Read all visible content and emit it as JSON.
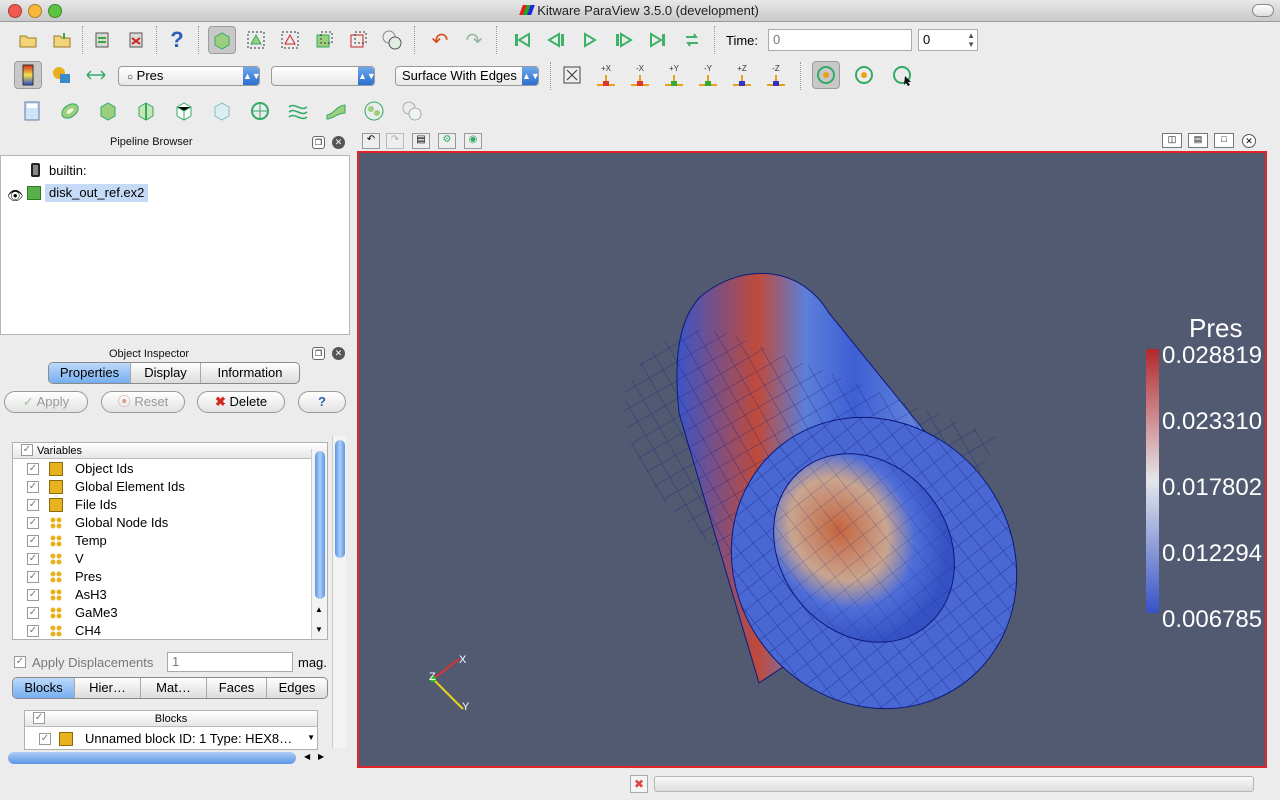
{
  "window": {
    "title": "Kitware ParaView 3.5.0 (development)"
  },
  "toolbar_main": {
    "time_label": "Time:",
    "time_value": "0",
    "time_step": "0"
  },
  "toolbar_color": {
    "array_combo": "Pres",
    "component_combo": "",
    "representation_combo": "Surface With Edges",
    "camera_labels": [
      "+X",
      "-X",
      "+Y",
      "-Y",
      "+Z",
      "-Z"
    ]
  },
  "pipeline": {
    "title": "Pipeline Browser",
    "items": [
      {
        "label": "builtin:"
      },
      {
        "label": "disk_out_ref.ex2"
      }
    ]
  },
  "inspector": {
    "title": "Object Inspector",
    "tabs": [
      {
        "label": "Properties",
        "selected": true
      },
      {
        "label": "Display"
      },
      {
        "label": "Information"
      }
    ],
    "apply_label": "Apply",
    "reset_label": "Reset",
    "delete_label": "Delete",
    "help_label": "?",
    "variables_header": "Variables",
    "variables": [
      {
        "name": "Object Ids",
        "icon": "cell"
      },
      {
        "name": "Global Element Ids",
        "icon": "cell"
      },
      {
        "name": "File Ids",
        "icon": "cell"
      },
      {
        "name": "Global Node Ids",
        "icon": "point"
      },
      {
        "name": "Temp",
        "icon": "point"
      },
      {
        "name": "V",
        "icon": "point"
      },
      {
        "name": "Pres",
        "icon": "point"
      },
      {
        "name": "AsH3",
        "icon": "point"
      },
      {
        "name": "GaMe3",
        "icon": "point"
      },
      {
        "name": "CH4",
        "icon": "point"
      }
    ],
    "apply_displacements_label": "Apply Displacements",
    "displacement_value": "1",
    "mag_label": "mag.",
    "block_tabs": [
      {
        "label": "Blocks",
        "selected": true
      },
      {
        "label": "Hier…"
      },
      {
        "label": "Mat…"
      },
      {
        "label": "Faces"
      },
      {
        "label": "Edges"
      }
    ],
    "blocks_header": "Blocks",
    "block_row": "Unnamed block ID: 1 Type: HEX8…"
  },
  "render_view": {
    "colorbar": {
      "title": "Pres",
      "labels": [
        "0.028819",
        "0.023310",
        "0.017802",
        "0.012294",
        "0.006785"
      ]
    },
    "axes": {
      "x": "X",
      "y": "Y",
      "z": "Z"
    },
    "background": "#525a72",
    "active_border": "#e0242a"
  },
  "colors": {
    "selection": "#c5daf6",
    "accent_blue": "#2a6ed1"
  }
}
